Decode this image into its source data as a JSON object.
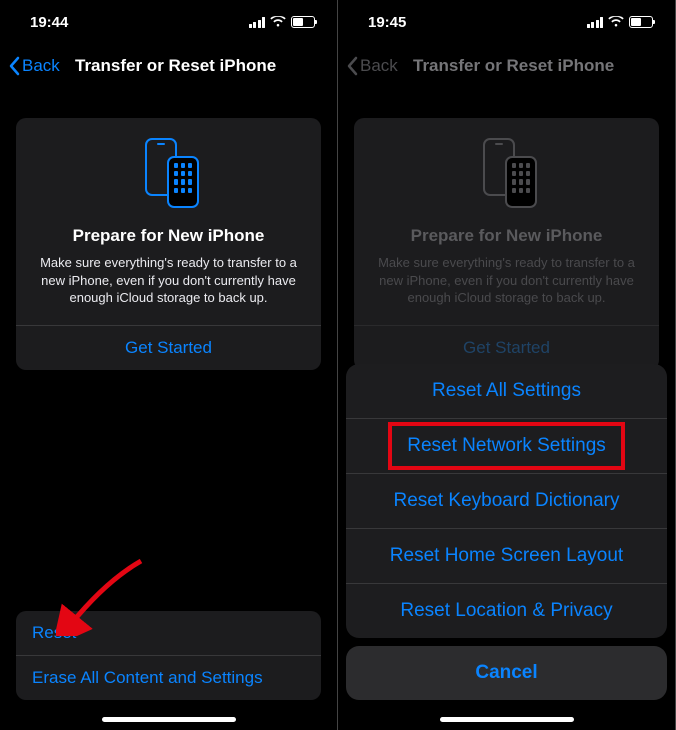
{
  "left": {
    "status": {
      "time": "19:44",
      "battery": "49"
    },
    "nav": {
      "back": "Back",
      "title": "Transfer or Reset iPhone"
    },
    "card": {
      "title": "Prepare for New iPhone",
      "desc": "Make sure everything's ready to transfer to a new iPhone, even if you don't currently have enough iCloud storage to back up.",
      "action": "Get Started"
    },
    "list": {
      "reset": "Reset",
      "erase": "Erase All Content and Settings"
    }
  },
  "right": {
    "status": {
      "time": "19:45",
      "battery": "49"
    },
    "nav": {
      "back": "Back",
      "title": "Transfer or Reset iPhone"
    },
    "card": {
      "title": "Prepare for New iPhone",
      "desc": "Make sure everything's ready to transfer to a new iPhone, even if you don't currently have enough iCloud storage to back up.",
      "action": "Get Started"
    },
    "sheet": {
      "items": [
        "Reset All Settings",
        "Reset Network Settings",
        "Reset Keyboard Dictionary",
        "Reset Home Screen Layout",
        "Reset Location & Privacy"
      ],
      "cancel": "Cancel"
    }
  }
}
